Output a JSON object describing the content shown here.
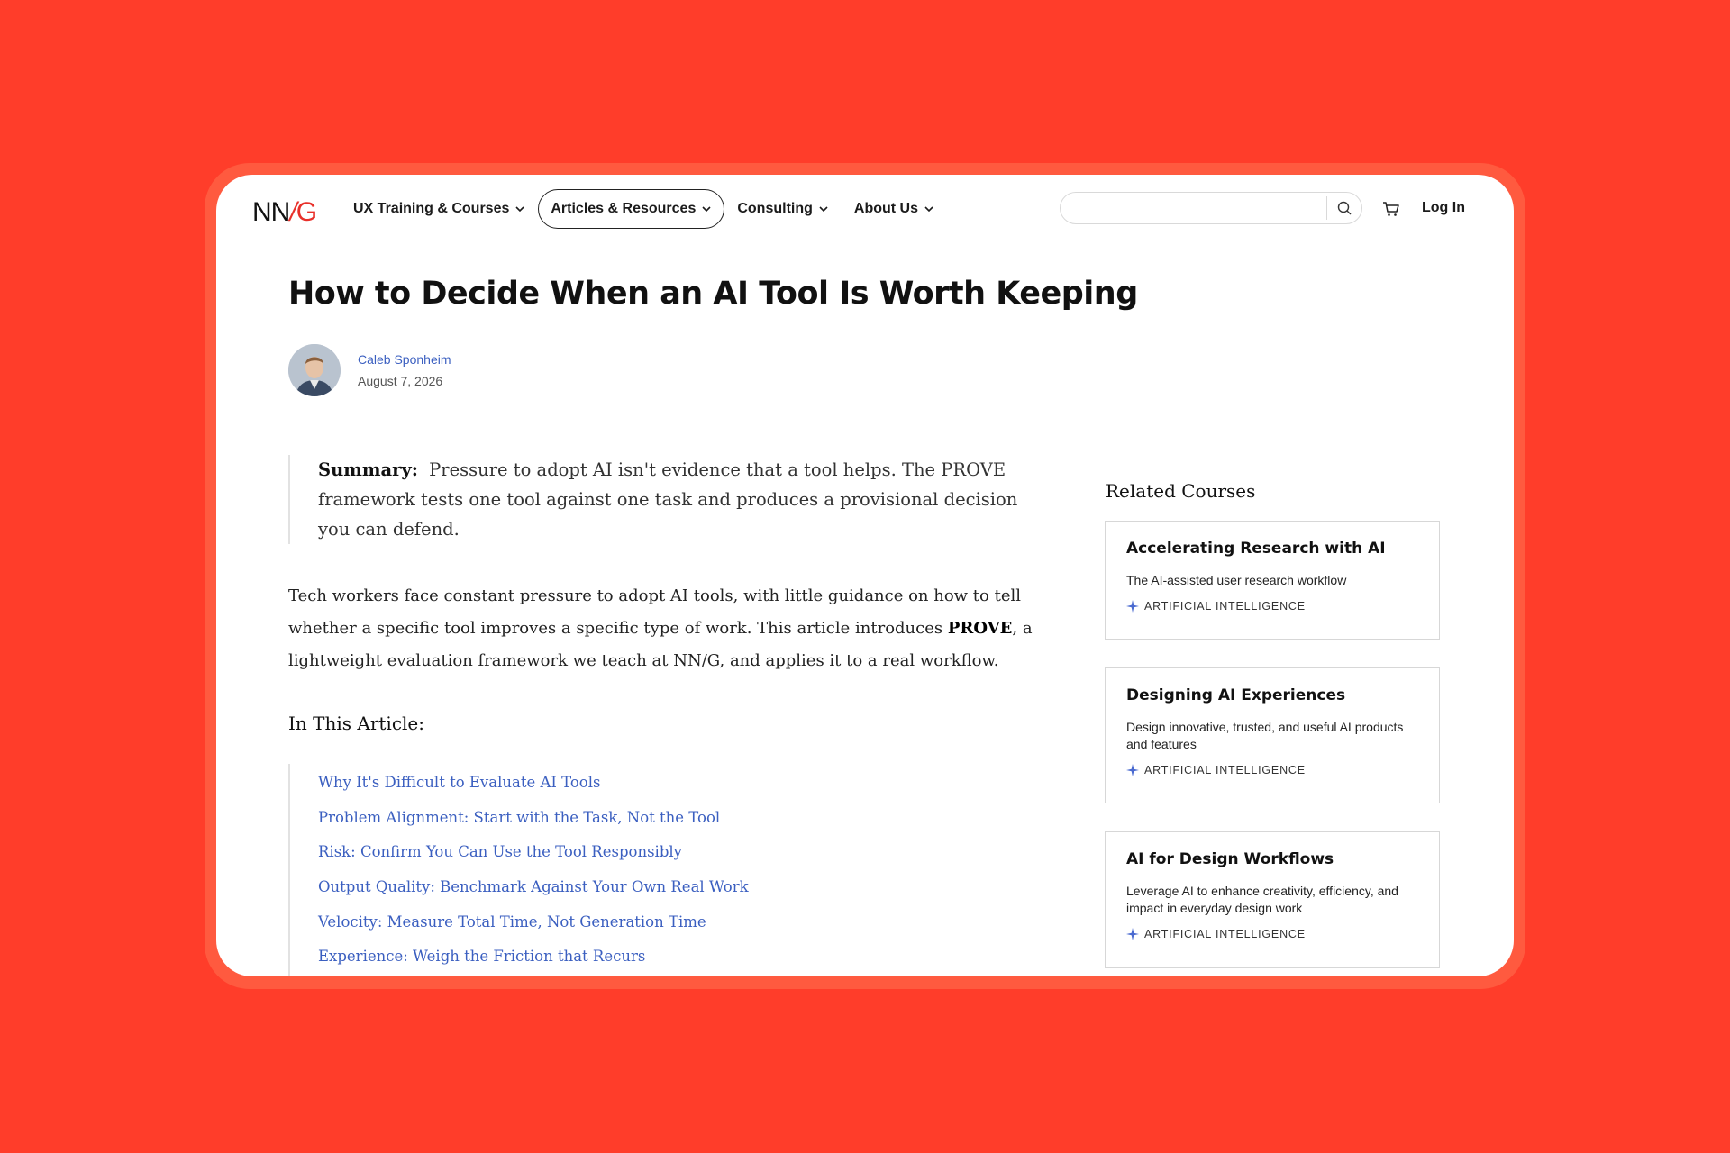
{
  "header": {
    "logo": {
      "nn": "NN",
      "slash": "/",
      "g": "G"
    },
    "nav": [
      {
        "label": "UX Training & Courses",
        "active": false
      },
      {
        "label": "Articles & Resources",
        "active": true
      },
      {
        "label": "Consulting",
        "active": false
      },
      {
        "label": "About Us",
        "active": false
      }
    ],
    "search_placeholder": "",
    "login_label": "Log In"
  },
  "article": {
    "title": "How to Decide When an AI Tool Is Worth Keeping",
    "author": "Caleb Sponheim",
    "date": "August 7, 2026",
    "summary_label": "Summary:",
    "summary_text": "Pressure to adopt AI isn't evidence that a tool helps. The PROVE framework tests one tool against one task and produces a provisional decision you can defend.",
    "intro_before": "Tech workers face constant pressure to adopt AI tools, with little guidance on how to tell whether a specific tool improves a specific type of work. This article introduces ",
    "intro_bold": "PROVE",
    "intro_after": ", a lightweight evaluation framework we teach at NN/G, and applies it to a real workflow.",
    "toc_title": "In This Article:",
    "toc": [
      "Why It's Difficult to Evaluate AI Tools",
      "Problem Alignment: Start with the Task, Not the Tool",
      "Risk: Confirm You Can Use the Tool Responsibly",
      "Output Quality: Benchmark Against Your Own Real Work",
      "Velocity: Measure Total Time, Not Generation Time",
      "Experience: Weigh the Friction that Recurs"
    ]
  },
  "sidebar": {
    "title": "Related Courses",
    "courses": [
      {
        "title": "Accelerating Research with AI",
        "desc": "The AI-assisted user research workflow",
        "tag": "ARTIFICIAL INTELLIGENCE"
      },
      {
        "title": "Designing AI Experiences",
        "desc": "Design innovative, trusted, and useful AI products and features",
        "tag": "ARTIFICIAL INTELLIGENCE"
      },
      {
        "title": "AI for Design Workflows",
        "desc": "Leverage AI to enhance creativity, efficiency, and impact in everyday design work",
        "tag": "ARTIFICIAL INTELLIGENCE"
      }
    ]
  },
  "colors": {
    "background": "#ff3d2a",
    "link": "#3b5fc0",
    "brand_red": "#e8302a"
  },
  "icons": [
    "chevron-down-icon",
    "search-icon",
    "cart-icon",
    "sparkle-icon"
  ]
}
